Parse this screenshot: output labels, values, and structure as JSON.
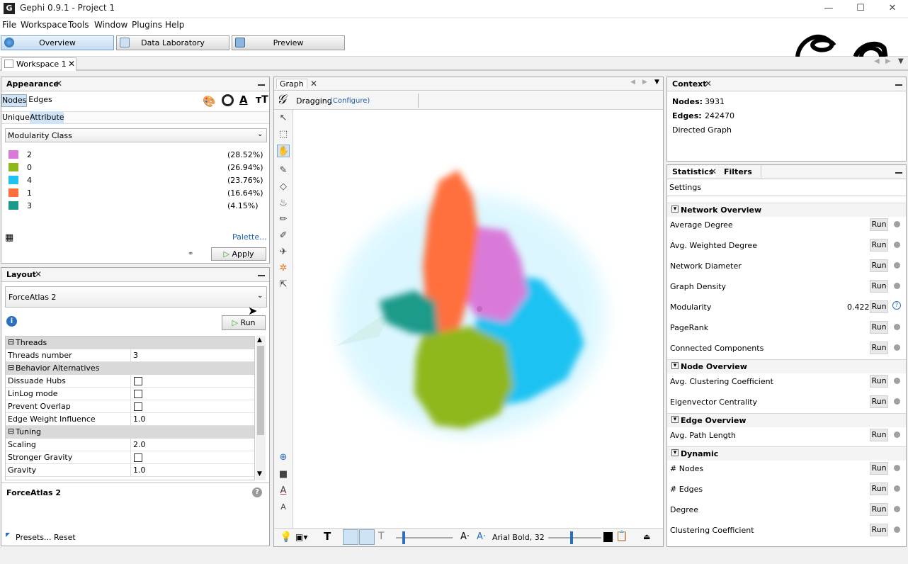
{
  "window": {
    "title": "Gephi 0.9.1 - Project 1",
    "app_icon": "gephi-icon"
  },
  "menu": [
    "File",
    "Workspace",
    "Tools",
    "Window",
    "Plugins",
    "Help"
  ],
  "main_tabs": [
    {
      "label": "Overview",
      "active": true
    },
    {
      "label": "Data Laboratory",
      "active": false
    },
    {
      "label": "Preview",
      "active": false
    }
  ],
  "workspace": {
    "tab": "Workspace 1"
  },
  "appearance": {
    "title": "Appearance",
    "subtabs": [
      "Nodes",
      "Edges"
    ],
    "modes": [
      "Unique",
      "Attribute"
    ],
    "attribute": "Modularity Class",
    "legend": [
      {
        "label": "2",
        "pct": "(28.52%)",
        "color": "#d97ad9"
      },
      {
        "label": "0",
        "pct": "(26.94%)",
        "color": "#8fb81a"
      },
      {
        "label": "4",
        "pct": "(23.76%)",
        "color": "#1ec3f2"
      },
      {
        "label": "1",
        "pct": "(16.64%)",
        "color": "#ff6f3e"
      },
      {
        "label": "3",
        "pct": "(4.15%)",
        "color": "#1a9a8a"
      }
    ],
    "palette": "Palette...",
    "apply": "Apply"
  },
  "layout": {
    "title": "Layout",
    "algorithm": "ForceAtlas 2",
    "run": "Run",
    "categories": {
      "threads": "Threads",
      "behavior": "Behavior Alternatives",
      "tuning": "Tuning"
    },
    "props": {
      "threads_number": {
        "label": "Threads number",
        "value": "3"
      },
      "dissuade_hubs": {
        "label": "Dissuade Hubs"
      },
      "linlog": {
        "label": "LinLog mode"
      },
      "prevent_overlap": {
        "label": "Prevent Overlap"
      },
      "edge_weight": {
        "label": "Edge Weight Influence",
        "value": "1.0"
      },
      "scaling": {
        "label": "Scaling",
        "value": "2.0"
      },
      "stronger_gravity": {
        "label": "Stronger Gravity"
      },
      "gravity": {
        "label": "Gravity",
        "value": "1.0"
      }
    },
    "desc_title": "ForceAtlas 2",
    "presets": "Presets...",
    "reset": "Reset"
  },
  "graph": {
    "tab": "Graph",
    "mode": "Dragging",
    "configure": "(Configure)",
    "font_label": "Arial Bold, 32"
  },
  "context": {
    "title": "Context",
    "nodes_label": "Nodes:",
    "nodes_value": "3931",
    "edges_label": "Edges:",
    "edges_value": "242470",
    "graph_type": "Directed Graph"
  },
  "statistics": {
    "tabs": [
      "Statistics",
      "Filters"
    ],
    "settings": "Settings",
    "run_label": "Run",
    "sections": {
      "network": "Network Overview",
      "node": "Node Overview",
      "edge": "Edge Overview",
      "dynamic": "Dynamic"
    },
    "rows": {
      "avg_degree": "Average Degree",
      "avg_weighted_degree": "Avg. Weighted Degree",
      "network_diameter": "Network Diameter",
      "graph_density": "Graph Density",
      "modularity": "Modularity",
      "modularity_value": "0.422",
      "pagerank": "PageRank",
      "connected_components": "Connected Components",
      "avg_clustering": "Avg. Clustering Coefficient",
      "eigenvector": "Eigenvector Centrality",
      "avg_path_length": "Avg. Path Length",
      "dyn_nodes": "# Nodes",
      "dyn_edges": "# Edges",
      "degree": "Degree",
      "clustering": "Clustering Coefficient"
    }
  }
}
